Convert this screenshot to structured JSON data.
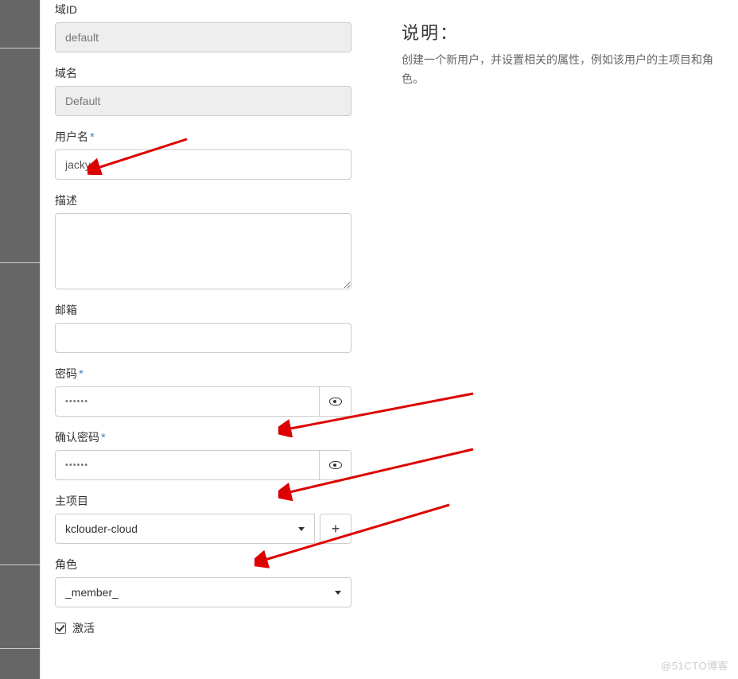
{
  "desc": {
    "title": "说明：",
    "text": "创建一个新用户，并设置相关的属性，例如该用户的主项目和角色。"
  },
  "form": {
    "domain_id": {
      "label": "域ID",
      "value": "default"
    },
    "domain_name": {
      "label": "域名",
      "value": "Default"
    },
    "username": {
      "label": "用户名",
      "required": "*",
      "value": "jacky"
    },
    "description": {
      "label": "描述",
      "value": ""
    },
    "email": {
      "label": "邮箱",
      "value": ""
    },
    "password": {
      "label": "密码",
      "required": "*",
      "value": "••••••"
    },
    "confirm_password": {
      "label": "确认密码",
      "required": "*",
      "value": "••••••"
    },
    "main_project": {
      "label": "主项目",
      "selected": "kclouder-cloud",
      "add": "+"
    },
    "role": {
      "label": "角色",
      "selected": "_member_"
    },
    "activate": {
      "label": "激活",
      "checked": true
    }
  },
  "watermark": "@51CTO博客"
}
